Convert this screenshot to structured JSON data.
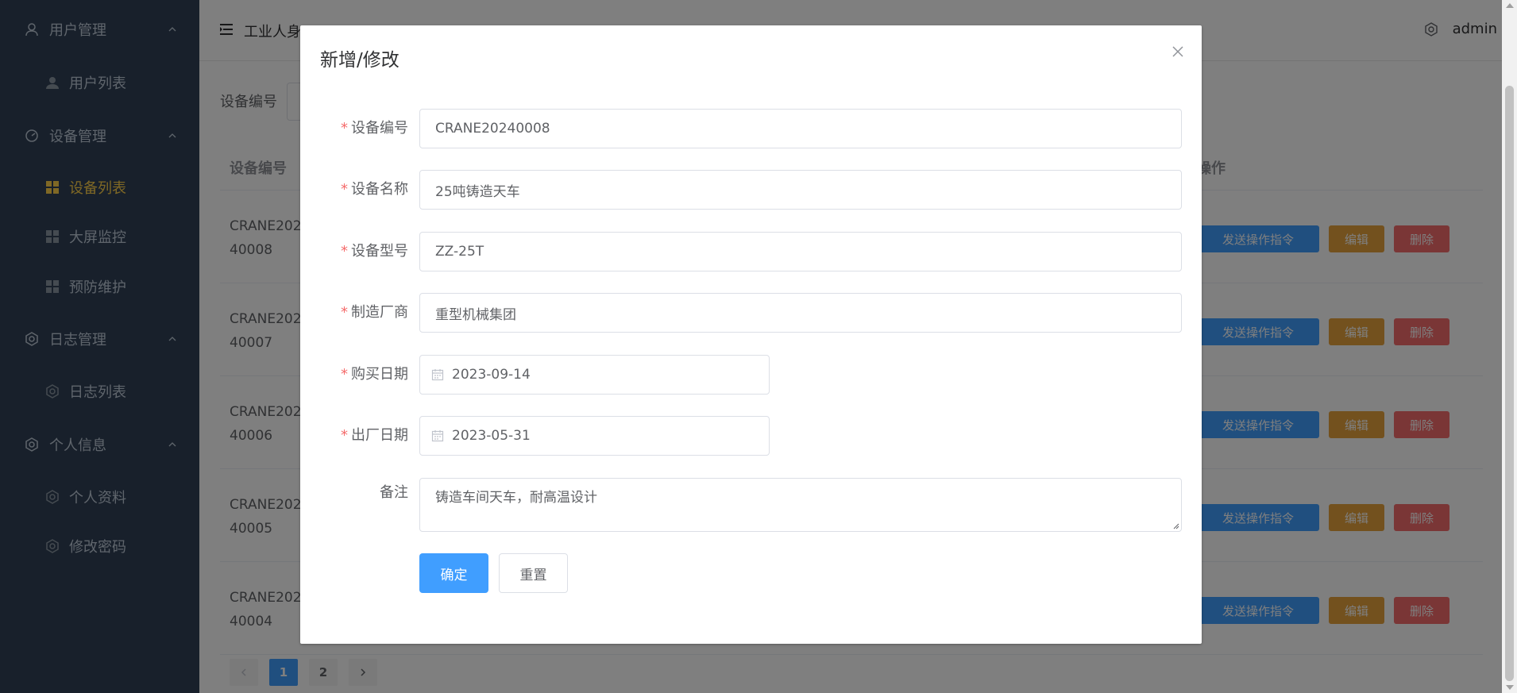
{
  "sidebar": {
    "groups": [
      {
        "label": "用户管理",
        "items": [
          {
            "label": "用户列表"
          }
        ]
      },
      {
        "label": "设备管理",
        "items": [
          {
            "label": "设备列表"
          },
          {
            "label": "大屏监控"
          },
          {
            "label": "预防维护"
          }
        ]
      },
      {
        "label": "日志管理",
        "items": [
          {
            "label": "日志列表"
          }
        ]
      },
      {
        "label": "个人信息",
        "items": [
          {
            "label": "个人资料"
          },
          {
            "label": "修改密码"
          }
        ]
      }
    ],
    "active_item": "设备列表",
    "active_color": "#ffd04b"
  },
  "navbar": {
    "breadcrumb": "工业人身",
    "username": "admin"
  },
  "search": {
    "label": "设备编号"
  },
  "table": {
    "headers": {
      "code": "设备编号",
      "actions": "操作"
    },
    "rows": [
      {
        "code_line1": "CRANE202",
        "code_line2": "40008"
      },
      {
        "code_line1": "CRANE202",
        "code_line2": "40007"
      },
      {
        "code_line1": "CRANE202",
        "code_line2": "40006"
      },
      {
        "code_line1": "CRANE202",
        "code_line2": "40005"
      },
      {
        "code_line1": "CRANE202",
        "code_line2": "40004"
      }
    ],
    "actions": {
      "send": "发送操作指令",
      "edit": "编辑",
      "delete": "删除"
    }
  },
  "pagination": {
    "pages": [
      "1",
      "2"
    ],
    "current": "1"
  },
  "dialog": {
    "title": "新增/修改",
    "fields": {
      "code": {
        "label": "设备编号",
        "value": "CRANE20240008",
        "required": "*"
      },
      "name": {
        "label": "设备名称",
        "value": "25吨铸造天车",
        "required": "*"
      },
      "model": {
        "label": "设备型号",
        "value": "ZZ-25T",
        "required": "*"
      },
      "maker": {
        "label": "制造厂商",
        "value": "重型机械集团",
        "required": "*"
      },
      "purchase_date": {
        "label": "购买日期",
        "value": "2023-09-14",
        "required": "*"
      },
      "factory_date": {
        "label": "出厂日期",
        "value": "2023-05-31",
        "required": "*"
      },
      "remark": {
        "label": "备注",
        "value": "铸造车间天车，耐高温设计"
      }
    },
    "buttons": {
      "confirm": "确定",
      "reset": "重置"
    }
  },
  "colors": {
    "primary": "#409eff",
    "warning": "#e6a23c",
    "danger": "#f56c6c",
    "sidebar_bg": "#304156"
  }
}
